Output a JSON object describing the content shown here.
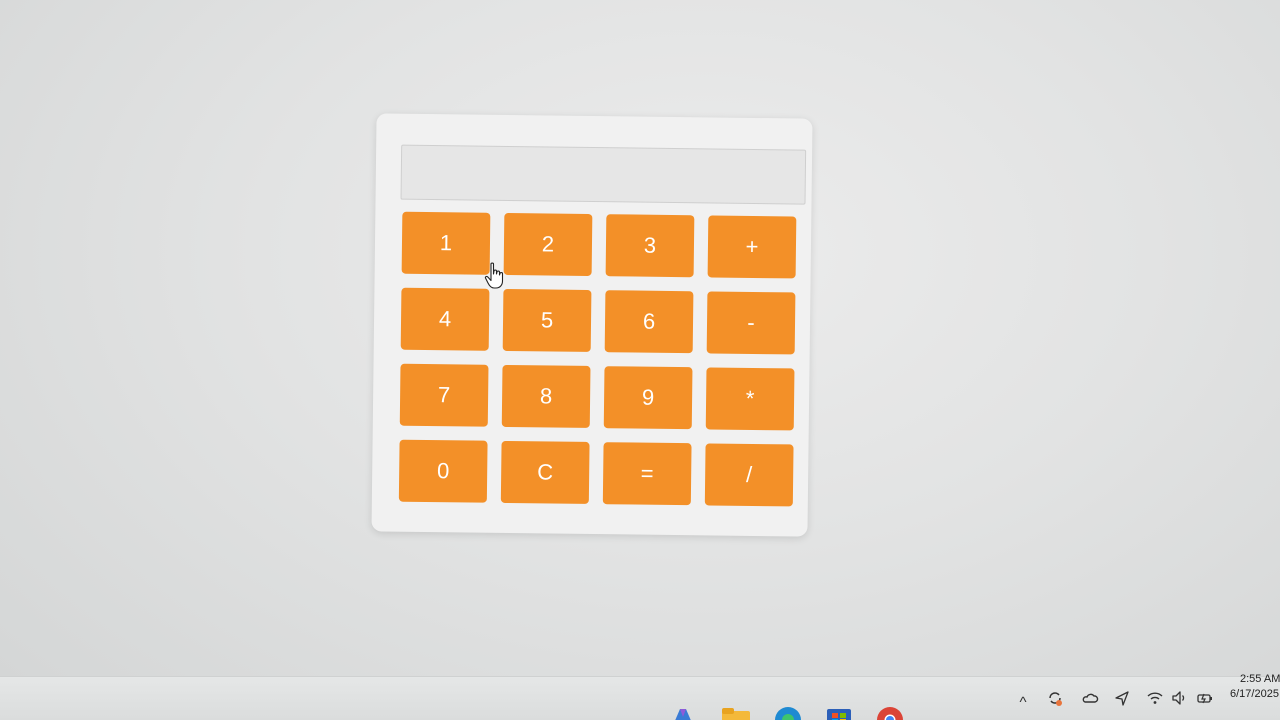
{
  "calculator": {
    "display_value": "",
    "keys": [
      "1",
      "2",
      "3",
      "+",
      "4",
      "5",
      "6",
      "-",
      "7",
      "8",
      "9",
      "*",
      "0",
      "C",
      "=",
      "/"
    ],
    "key_color": "#f39028",
    "key_text_color": "#ffffff"
  },
  "taskbar": {
    "apps": [
      "copilot-icon",
      "file-explorer-icon",
      "edge-browser-icon",
      "microsoft-store-icon",
      "chrome-icon"
    ],
    "tray": {
      "chevron": "^",
      "icons": [
        "sync-icon",
        "onedrive-cloud-icon",
        "location-icon",
        "wifi-icon",
        "volume-icon",
        "battery-icon"
      ]
    },
    "clock": {
      "time": "2:55 AM",
      "date": "6/17/2025"
    }
  }
}
